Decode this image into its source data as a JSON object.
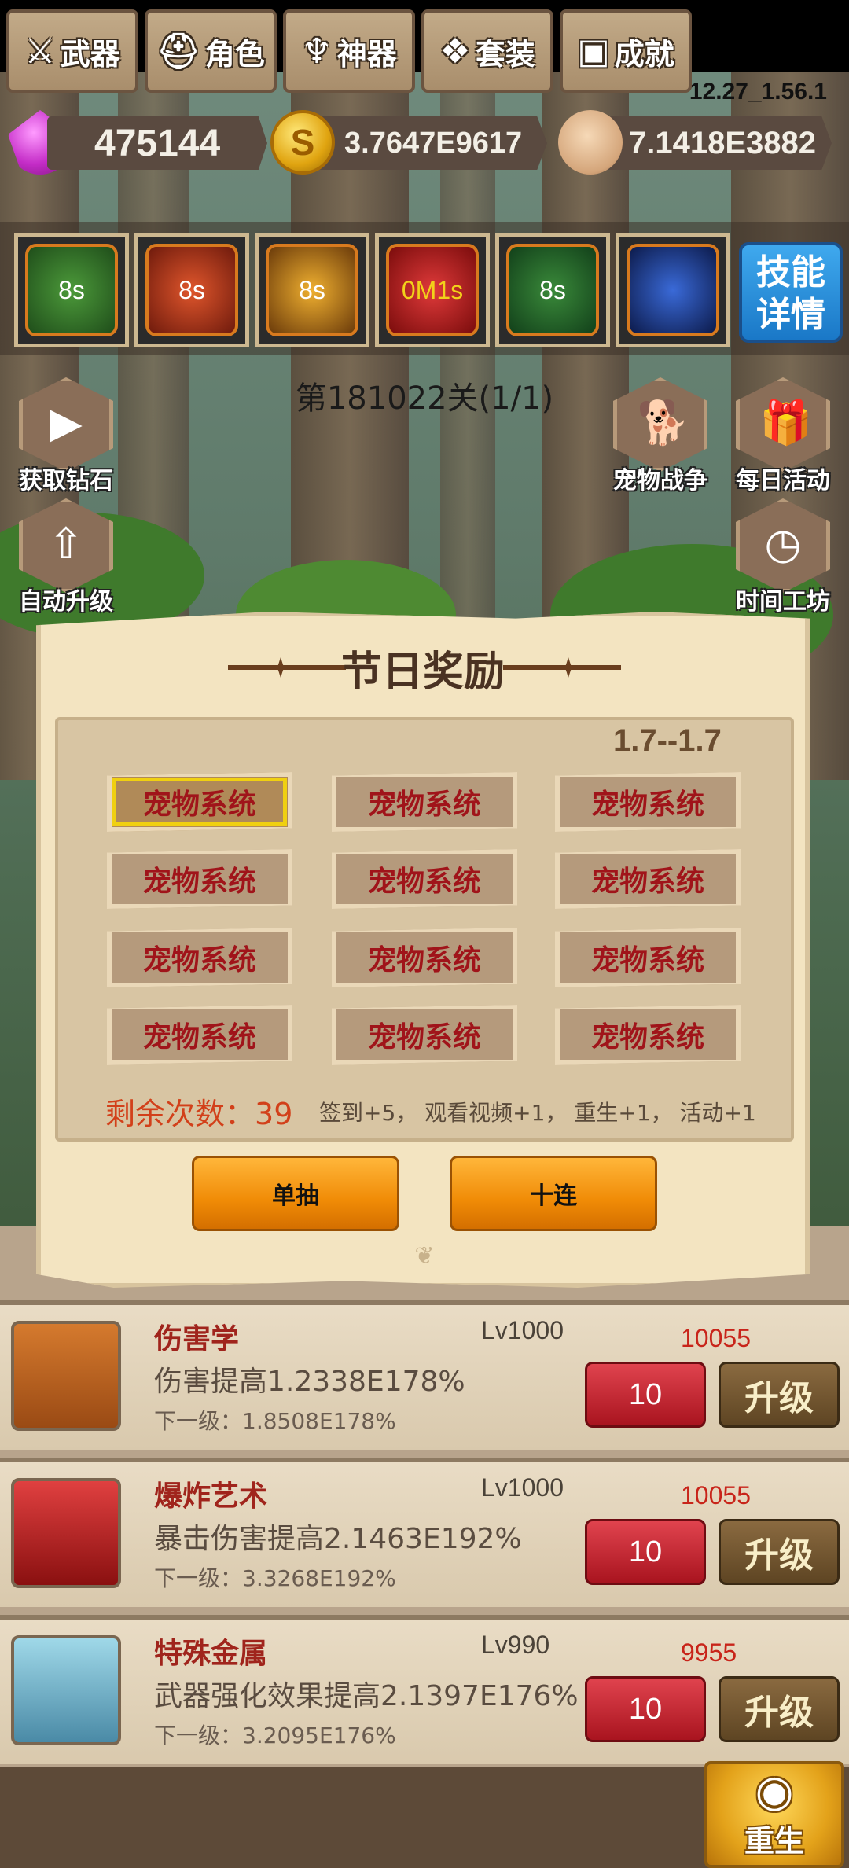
{
  "version": "12.27_1.56.1",
  "resources": {
    "diamonds": "475144",
    "gold": "3.7647E9617",
    "skulls": "7.1418E3882",
    "coin_symbol": "S"
  },
  "skills": [
    "8s",
    "8s",
    "8s",
    "0M1s",
    "8s",
    ""
  ],
  "skill_details_label": "技能\n详情",
  "stage": "第181022关(1/1)",
  "side_buttons": {
    "get_diamonds": "获取钻石",
    "auto_upgrade": "自动升级",
    "pet_war": "宠物战争",
    "daily_activity": "每日活动",
    "time_workshop": "时间工坊"
  },
  "upgrades": [
    {
      "name": "伤害学",
      "level": "Lv1000",
      "desc": "伤害提高1.2338E178%",
      "next": "下一级：1.8508E178%",
      "cost": "10055",
      "count": "10",
      "action": "升级"
    },
    {
      "name": "爆炸艺术",
      "level": "Lv1000",
      "desc": "暴击伤害提高2.1463E192%",
      "next": "下一级：3.3268E192%",
      "cost": "10055",
      "count": "10",
      "action": "升级"
    },
    {
      "name": "特殊金属",
      "level": "Lv990",
      "desc": "武器强化效果提高2.1397E176%",
      "next": "下一级：3.2095E176%",
      "cost": "9955",
      "count": "10",
      "action": "升级"
    }
  ],
  "nav": [
    "武器",
    "角色",
    "神器",
    "套装",
    "成就"
  ],
  "rebirth_label": "重生",
  "dialog": {
    "title": "节日奖励",
    "period": "1.7--1.7",
    "cells": [
      "宠物系统",
      "宠物系统",
      "宠物系统",
      "宠物系统",
      "宠物系统",
      "宠物系统",
      "宠物系统",
      "宠物系统",
      "宠物系统",
      "宠物系统",
      "宠物系统",
      "宠物系统"
    ],
    "remaining_label": "剩余次数：",
    "remaining_value": "39",
    "rules": "签到+5， 观看视频+1， 重生+1， 活动+1",
    "single_draw": "单抽",
    "ten_draw": "十连"
  }
}
